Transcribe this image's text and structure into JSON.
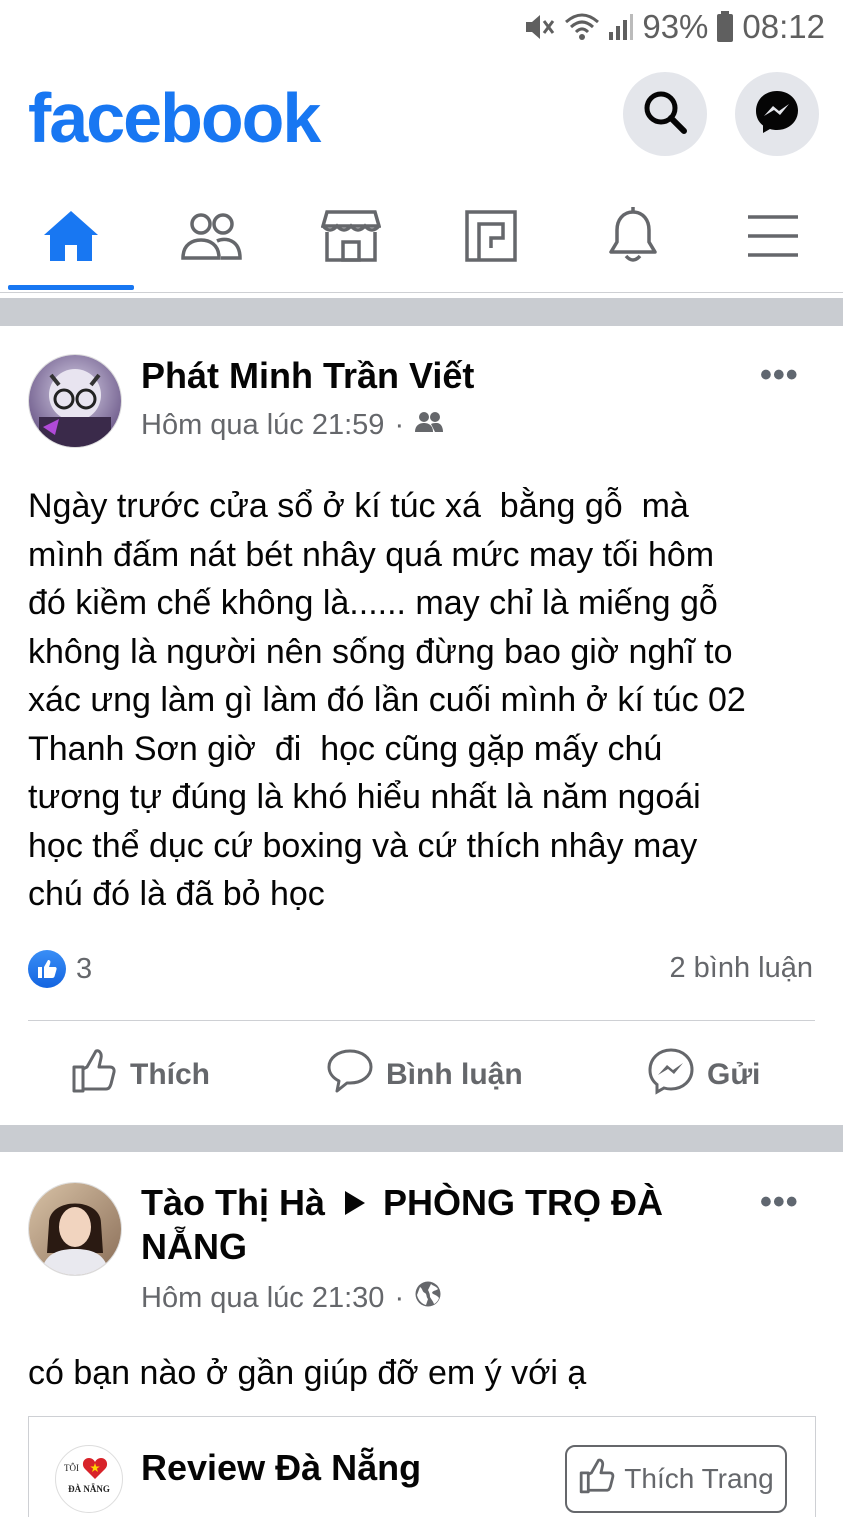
{
  "status_bar": {
    "battery": "93%",
    "time": "08:12"
  },
  "header": {
    "logo": "facebook"
  },
  "nav": {
    "items": [
      "home-icon",
      "friends-icon",
      "marketplace-icon",
      "pages-icon",
      "notifications-icon",
      "menu-icon"
    ],
    "active": "home"
  },
  "posts": [
    {
      "author": "Phát Minh Trần Viết",
      "time": "Hôm qua lúc 21:59",
      "audience_icon": "friends-icon",
      "text": "Ngày trước cửa sổ ở kí túc xá  bằng gỗ  mà\nmình đấm nát bét nhây quá mức may tối hôm\nđó kiềm chế không là...... may chỉ là miếng gỗ\nkhông là người nên sống đừng bao giờ nghĩ to\nxác ưng làm gì làm đó lần cuối mình ở kí túc 02\nThanh Sơn giờ  đi  học cũng gặp mấy chú\ntương tự đúng là khó hiểu nhất là năm ngoái\nhọc thể dục cứ boxing và cứ thích nhây may\nchú đó là đã bỏ học",
      "likes": "3",
      "comments": "2 bình luận",
      "actions": {
        "like": "Thích",
        "comment": "Bình luận",
        "send": "Gửi"
      }
    },
    {
      "author": "Tào Thị Hà",
      "group": "PHÒNG TRỌ ĐÀ\nNẴNG",
      "time": "Hôm qua lúc 21:30",
      "audience_icon": "globe-icon",
      "text": "có bạn nào ở gần giúp đỡ em ý với ạ",
      "shared_page": {
        "logo_text_top": "TÔI",
        "logo_text_bottom": "ĐÀ NẴNG",
        "name": "Review Đà Nẵng",
        "like_page_label": "Thích Trang"
      }
    }
  ],
  "colors": {
    "brand": "#1877f2",
    "secondary_text": "#65676b",
    "separator": "#c9ccd1",
    "icon_bg": "#e4e6eb"
  }
}
